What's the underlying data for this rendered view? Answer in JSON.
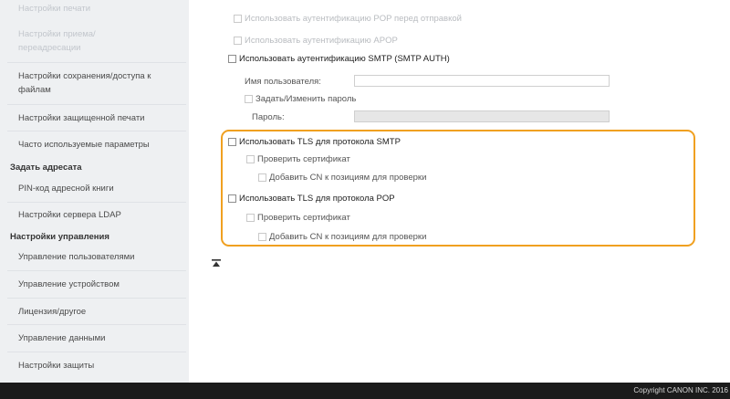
{
  "sidebar": {
    "top_faded": "Настройки печати",
    "items_group1": [
      {
        "label": "Настройки приема/переадресации",
        "faded": true
      },
      {
        "label": "Настройки сохранения/доступа к файлам",
        "faded": false
      },
      {
        "label": "Настройки защищенной печати",
        "faded": false
      },
      {
        "label": "Часто используемые параметры",
        "faded": false
      }
    ],
    "heading_address": "Задать адресата",
    "items_group2": [
      {
        "label": "PIN-код адресной книги"
      },
      {
        "label": "Настройки сервера LDAP"
      }
    ],
    "heading_management": "Настройки управления",
    "items_group3": [
      {
        "label": "Управление пользователями"
      },
      {
        "label": "Управление устройством"
      },
      {
        "label": "Лицензия/другое"
      },
      {
        "label": "Управление данными"
      },
      {
        "label": "Настройки защиты"
      }
    ]
  },
  "form": {
    "pop_before_send": "Использовать аутентификацию POP перед отправкой",
    "use_apop": "Использовать аутентификацию APOP",
    "use_smtp_auth": "Использовать аутентификацию SMTP (SMTP AUTH)",
    "username_label": "Имя пользователя:",
    "username_value": "",
    "set_change_password": "Задать/Изменить пароль",
    "password_label": "Пароль:",
    "password_value": "",
    "use_tls_smtp": "Использовать TLS для протокола SMTP",
    "verify_cert_smtp": "Проверить сертификат",
    "add_cn_smtp": "Добавить CN к позициям для проверки",
    "use_tls_pop": "Использовать TLS для протокола POP",
    "verify_cert_pop": "Проверить сертификат",
    "add_cn_pop": "Добавить CN к позициям для проверки"
  },
  "highlight_color": "#f0a020",
  "footer": {
    "copyright": "Copyright CANON INC. 2016"
  }
}
